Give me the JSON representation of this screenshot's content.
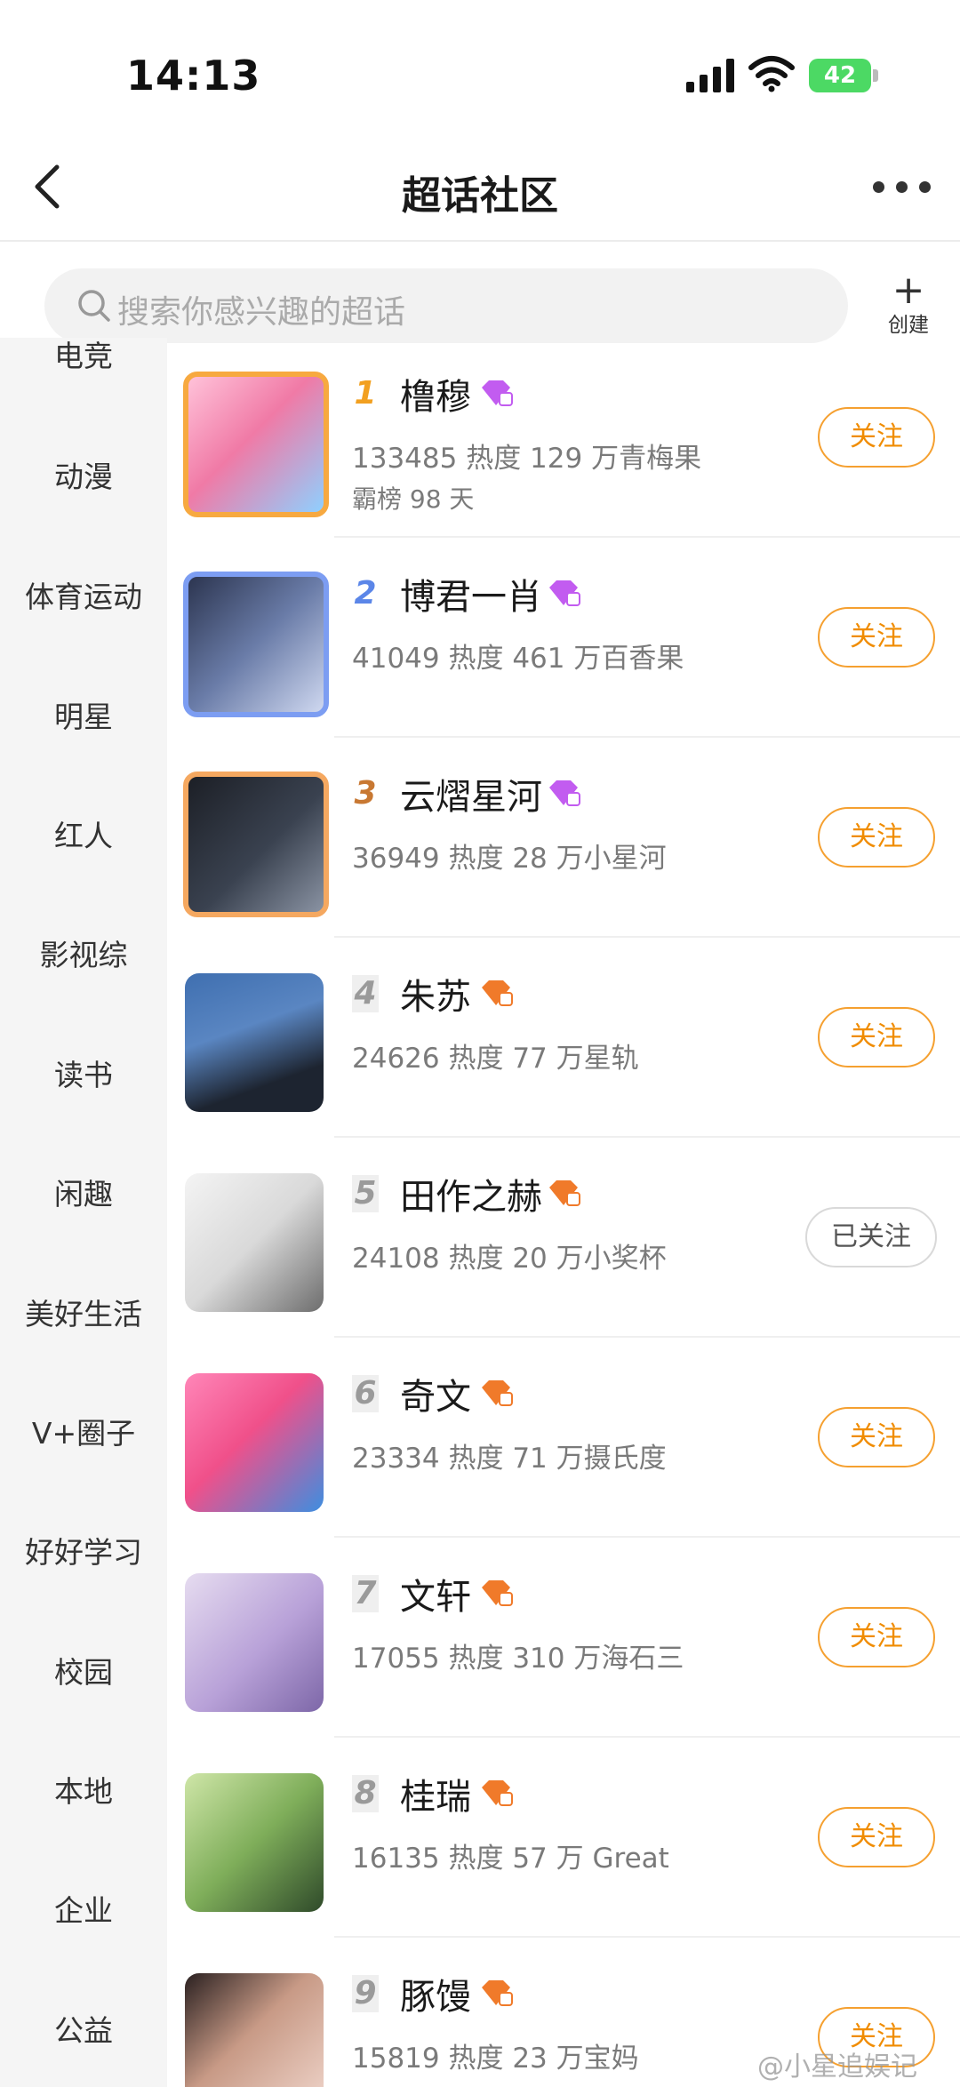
{
  "status_bar": {
    "time": "14:13",
    "battery": "42"
  },
  "header": {
    "title": "超话社区"
  },
  "search": {
    "placeholder": "搜索你感兴趣的超话",
    "create_label": "创建"
  },
  "sidebar": {
    "items": [
      {
        "label": "电竞"
      },
      {
        "label": "动漫"
      },
      {
        "label": "体育运动"
      },
      {
        "label": "明星"
      },
      {
        "label": "红人"
      },
      {
        "label": "影视综"
      },
      {
        "label": "读书"
      },
      {
        "label": "闲趣"
      },
      {
        "label": "美好生活"
      },
      {
        "label": "V+圈子"
      },
      {
        "label": "好好学习"
      },
      {
        "label": "校园"
      },
      {
        "label": "本地"
      },
      {
        "label": "企业"
      },
      {
        "label": "公益"
      }
    ]
  },
  "list": {
    "items": [
      {
        "rank": "1",
        "name": "橹穆",
        "stat": "133485 热度 129 万青梅果",
        "stat2": "霸榜 98 天",
        "follow": "关注",
        "followed": false,
        "badge_color": "#c25cf0"
      },
      {
        "rank": "2",
        "name": "博君一肖",
        "stat": "41049 热度 461 万百香果",
        "stat2": "",
        "follow": "关注",
        "followed": false,
        "badge_color": "#c25cf0"
      },
      {
        "rank": "3",
        "name": "云熠星河",
        "stat": "36949 热度 28 万小星河",
        "stat2": "",
        "follow": "关注",
        "followed": false,
        "badge_color": "#c25cf0"
      },
      {
        "rank": "4",
        "name": "朱苏",
        "stat": "24626 热度 77 万星轨",
        "stat2": "",
        "follow": "关注",
        "followed": false,
        "badge_color": "#f07a2a"
      },
      {
        "rank": "5",
        "name": "田作之赫",
        "stat": "24108 热度 20 万小奖杯",
        "stat2": "",
        "follow": "已关注",
        "followed": true,
        "badge_color": "#f07a2a"
      },
      {
        "rank": "6",
        "name": "奇文",
        "stat": "23334 热度 71 万摄氏度",
        "stat2": "",
        "follow": "关注",
        "followed": false,
        "badge_color": "#f07a2a"
      },
      {
        "rank": "7",
        "name": "文轩",
        "stat": "17055 热度 310 万海石三",
        "stat2": "",
        "follow": "关注",
        "followed": false,
        "badge_color": "#f07a2a"
      },
      {
        "rank": "8",
        "name": "桂瑞",
        "stat": "16135 热度 57 万 Great",
        "stat2": "",
        "follow": "关注",
        "followed": false,
        "badge_color": "#f07a2a"
      },
      {
        "rank": "9",
        "name": "豚馒",
        "stat": "15819 热度 23 万宝妈",
        "stat2": "",
        "follow": "关注",
        "followed": false,
        "badge_color": "#f07a2a"
      }
    ]
  },
  "watermark": "@小星追娱记"
}
